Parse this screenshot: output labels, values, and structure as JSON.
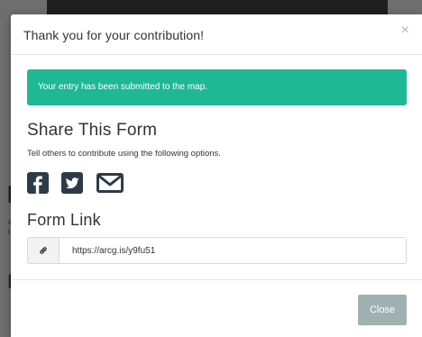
{
  "background_fragments": {
    "line1": "I",
    "line2": "a\nl",
    "line3": "D"
  },
  "modal": {
    "title": "Thank you for your contribution!",
    "close_symbol": "×",
    "alert_text": "Your entry has been submitted to the map.",
    "share_title": "Share This Form",
    "share_description": "Tell others to contribute using the following options.",
    "social_icons": [
      "facebook-icon",
      "twitter-icon",
      "email-icon"
    ],
    "form_link_title": "Form Link",
    "form_link_value": "https://arcg.is/y9fu51",
    "close_button_label": "Close"
  },
  "colors": {
    "alert": "#1fb895",
    "close_button": "#9fb2b1",
    "icon": "#2e3b47"
  }
}
